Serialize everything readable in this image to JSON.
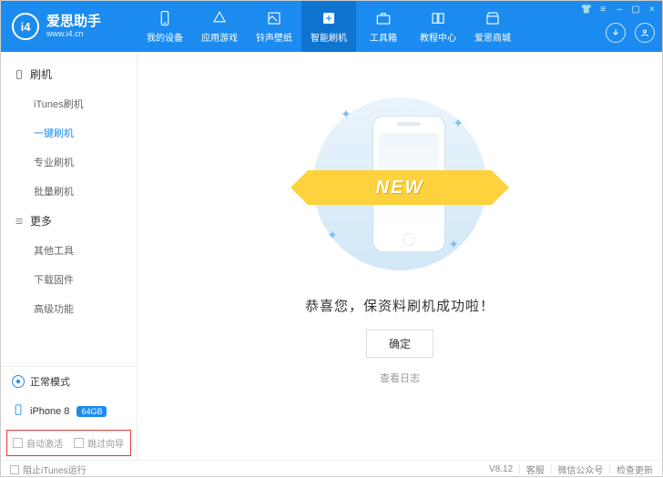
{
  "app": {
    "name": "爱思助手",
    "url": "www.i4.cn",
    "logo_text": "i4"
  },
  "nav": {
    "items": [
      {
        "label": "我的设备"
      },
      {
        "label": "应用游戏"
      },
      {
        "label": "铃声壁纸"
      },
      {
        "label": "智能刷机"
      },
      {
        "label": "工具箱"
      },
      {
        "label": "教程中心"
      },
      {
        "label": "爱思商城"
      }
    ],
    "active_index": 3
  },
  "sidebar": {
    "groups": [
      {
        "title": "刷机",
        "items": [
          {
            "label": "iTunes刷机"
          },
          {
            "label": "一键刷机"
          },
          {
            "label": "专业刷机"
          },
          {
            "label": "批量刷机"
          }
        ],
        "selected_index": 1
      },
      {
        "title": "更多",
        "items": [
          {
            "label": "其他工具"
          },
          {
            "label": "下载固件"
          },
          {
            "label": "高级功能"
          }
        ],
        "selected_index": -1
      }
    ],
    "mode": "正常模式",
    "device": {
      "name": "iPhone 8",
      "storage": "64GB"
    },
    "checks": {
      "auto_activate": "自动激活",
      "skip_wizard": "跳过向导"
    }
  },
  "main": {
    "ribbon": "NEW",
    "success_message": "恭喜您，保资料刷机成功啦！",
    "ok_button": "确定",
    "view_logs": "查看日志"
  },
  "footer": {
    "block_itunes": "阻止iTunes运行",
    "version": "V8.12",
    "support": "客服",
    "wechat": "微信公众号",
    "check_update": "检查更新"
  }
}
